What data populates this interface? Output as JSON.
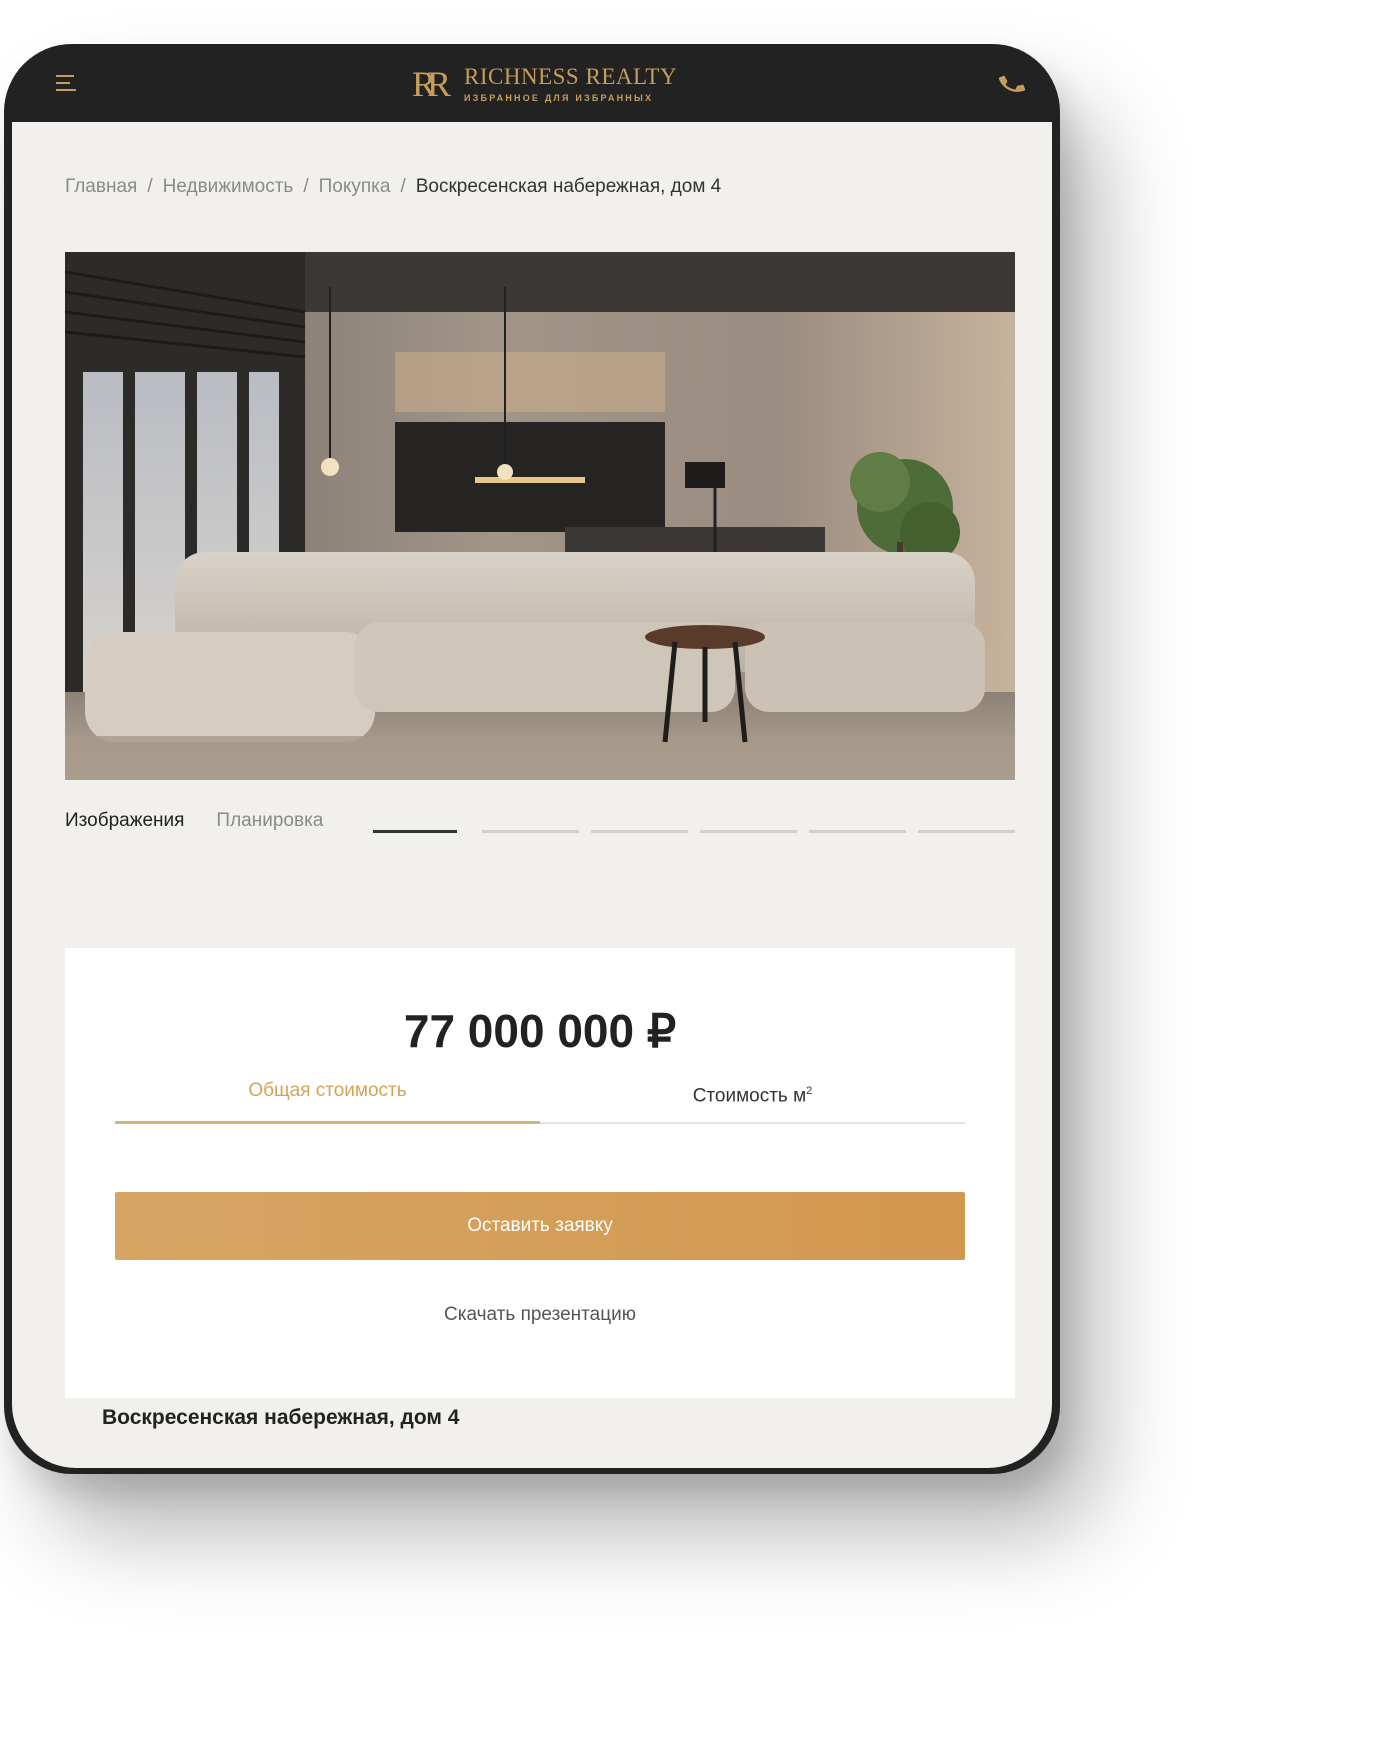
{
  "header": {
    "logo_mark": "RR",
    "brand_name": "RICHNESS REALTY",
    "tagline": "ИЗБРАННОЕ ДЛЯ ИЗБРАННЫХ",
    "accent_color": "#c79d5b",
    "menu_icon": "hamburger-menu-icon",
    "phone_icon": "phone-icon"
  },
  "breadcrumb": {
    "items": [
      "Главная",
      "Недвижимость",
      "Покупка"
    ],
    "current": "Воскресенская набережная, дом 4",
    "separator": "/"
  },
  "gallery": {
    "tabs": [
      "Изображения",
      "Планировка"
    ],
    "active_tab": "Изображения",
    "slide_count": 6,
    "active_slide": 1
  },
  "price_card": {
    "price": "77 000 000 ₽",
    "tabs": {
      "total": "Общая стоимость",
      "per_sqm": "Стоимость м",
      "per_sqm_sup": "2"
    },
    "active_tab": "Общая стоимость",
    "cta_label": "Оставить заявку",
    "download_label": "Скачать презентацию"
  },
  "section_title": "Воскресенская набережная, дом 4",
  "colors": {
    "accent": "#c79d5b",
    "button": "#d49f5a",
    "background": "#f1f0ed",
    "header_bg": "#222222"
  }
}
